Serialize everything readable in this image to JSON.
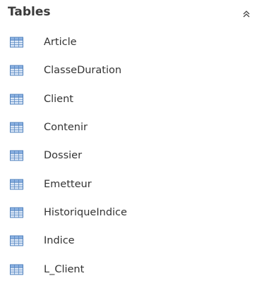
{
  "nav_pane": {
    "group_title": "Tables",
    "collapse_icon": "chevron-double-up-icon",
    "item_icon": "table-icon",
    "items": [
      {
        "label": "Article"
      },
      {
        "label": "ClasseDuration"
      },
      {
        "label": "Client"
      },
      {
        "label": "Contenir"
      },
      {
        "label": "Dossier"
      },
      {
        "label": "Emetteur"
      },
      {
        "label": "HistoriqueIndice"
      },
      {
        "label": "Indice"
      },
      {
        "label": "L_Client"
      }
    ]
  },
  "colors": {
    "icon_border": "#4f81bd",
    "icon_header": "#8fb4e3",
    "icon_cell": "#dbe7f7"
  }
}
